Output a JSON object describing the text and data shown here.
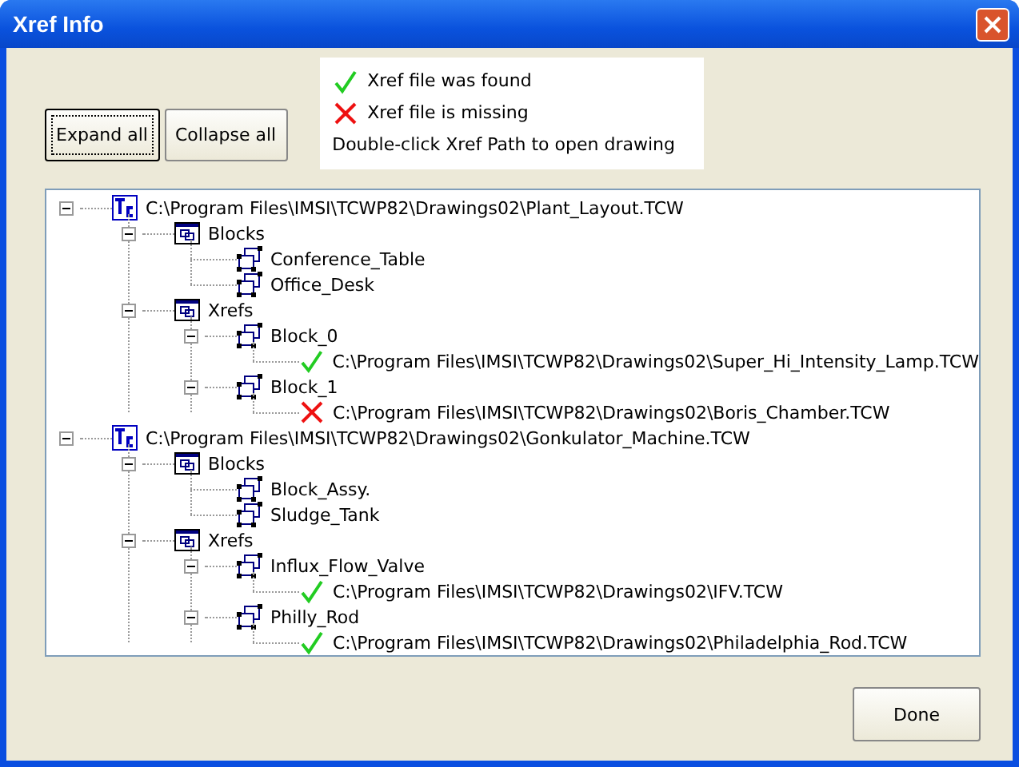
{
  "window": {
    "title": "Xref Info"
  },
  "buttons": [
    {
      "label": "Expand all",
      "focused": true
    },
    {
      "label": "Collapse all",
      "focused": false
    }
  ],
  "legend": [
    {
      "kind": "found",
      "text": "Xref file was found"
    },
    {
      "kind": "missing",
      "text": "Xref file is missing"
    },
    {
      "kind": "note",
      "text": "Double-click Xref Path to open drawing"
    }
  ],
  "tree": [
    {
      "kind": "drawing",
      "label": "C:\\Program Files\\IMSI\\TCWP82\\Drawings02\\Plant_Layout.TCW",
      "expanded": true,
      "children": [
        {
          "kind": "folder",
          "label": "Blocks",
          "expanded": true,
          "children": [
            {
              "kind": "block",
              "label": "Conference_Table"
            },
            {
              "kind": "block",
              "label": "Office_Desk"
            }
          ]
        },
        {
          "kind": "folder",
          "label": "Xrefs",
          "expanded": true,
          "children": [
            {
              "kind": "block",
              "label": "Block_0",
              "expanded": true,
              "children": [
                {
                  "kind": "found",
                  "label": "C:\\Program Files\\IMSI\\TCWP82\\Drawings02\\Super_Hi_Intensity_Lamp.TCW"
                }
              ]
            },
            {
              "kind": "block",
              "label": "Block_1",
              "expanded": true,
              "children": [
                {
                  "kind": "missing",
                  "label": "C:\\Program Files\\IMSI\\TCWP82\\Drawings02\\Boris_Chamber.TCW"
                }
              ]
            }
          ]
        }
      ]
    },
    {
      "kind": "drawing",
      "label": "C:\\Program Files\\IMSI\\TCWP82\\Drawings02\\Gonkulator_Machine.TCW",
      "expanded": true,
      "children": [
        {
          "kind": "folder",
          "label": "Blocks",
          "expanded": true,
          "children": [
            {
              "kind": "block",
              "label": "Block_Assy."
            },
            {
              "kind": "block",
              "label": "Sludge_Tank"
            }
          ]
        },
        {
          "kind": "folder",
          "label": "Xrefs",
          "expanded": true,
          "children": [
            {
              "kind": "block",
              "label": "Influx_Flow_Valve",
              "expanded": true,
              "children": [
                {
                  "kind": "found",
                  "label": "C:\\Program Files\\IMSI\\TCWP82\\Drawings02\\IFV.TCW"
                }
              ]
            },
            {
              "kind": "block",
              "label": "Philly_Rod",
              "expanded": true,
              "children": [
                {
                  "kind": "found",
                  "label": "C:\\Program Files\\IMSI\\TCWP82\\Drawings02\\Philadelphia_Rod.TCW"
                }
              ]
            }
          ]
        }
      ]
    }
  ],
  "done_button": {
    "label": "Done"
  }
}
